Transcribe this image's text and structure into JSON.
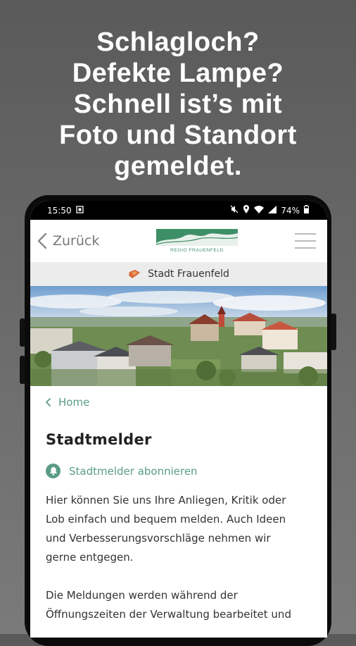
{
  "headline": {
    "line1": "Schlagloch?",
    "line2": "Defekte Lampe?",
    "line3": "Schnell ist’s mit",
    "line4": "Foto und Standort",
    "line5": "gemeldet."
  },
  "status_bar": {
    "time": "15:50",
    "battery": "74%",
    "icons": [
      "screenshot-icon",
      "mute-icon",
      "location-icon",
      "wifi-icon",
      "signal-icon"
    ]
  },
  "app_bar": {
    "back_label": "Zurück",
    "logo_text": "REGIO FRAUENFELD",
    "menu_icon": "hamburger-menu-icon"
  },
  "city_bar": {
    "label": "Stadt Frauenfeld"
  },
  "content": {
    "breadcrumb": "Home",
    "title": "Stadtmelder",
    "subscribe_label": "Stadtmelder abonnieren",
    "paragraph1_line1": "Hier können Sie uns Ihre Anliegen, Kritik oder",
    "paragraph1_line2": "Lob einfach und bequem melden. Auch Ideen",
    "paragraph1_line3": "und Verbesserungsvorschläge nehmen wir",
    "paragraph1_line4": "gerne entgegen.",
    "paragraph2_line1": "Die Meldungen werden während der",
    "paragraph2_line2": "Öffnungszeiten der Verwaltung bearbeitet und"
  },
  "colors": {
    "accent": "#5a9c84",
    "logo_green": "#3e8f68"
  }
}
